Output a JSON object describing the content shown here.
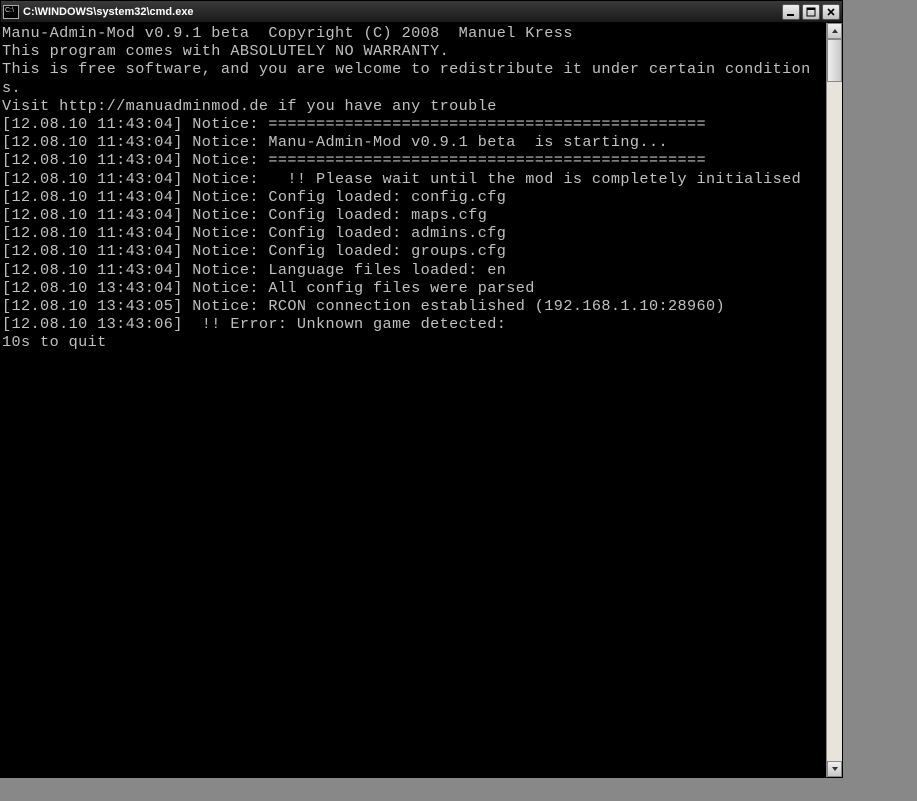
{
  "window": {
    "title": "C:\\WINDOWS\\system32\\cmd.exe"
  },
  "console": {
    "lines": [
      "Manu-Admin-Mod v0.9.1 beta  Copyright (C) 2008  Manuel Kress",
      "This program comes with ABSOLUTELY NO WARRANTY.",
      "This is free software, and you are welcome to redistribute it under certain conditions.",
      "Visit http://manuadminmod.de if you have any trouble",
      "",
      "[12.08.10 11:43:04] Notice: ==============================================",
      "[12.08.10 11:43:04] Notice: Manu-Admin-Mod v0.9.1 beta  is starting...",
      "[12.08.10 11:43:04] Notice: ==============================================",
      "[12.08.10 11:43:04] Notice:   !! Please wait until the mod is completely initialised",
      "[12.08.10 11:43:04] Notice: Config loaded: config.cfg",
      "[12.08.10 11:43:04] Notice: Config loaded: maps.cfg",
      "[12.08.10 11:43:04] Notice: Config loaded: admins.cfg",
      "[12.08.10 11:43:04] Notice: Config loaded: groups.cfg",
      "[12.08.10 11:43:04] Notice: Language files loaded: en",
      "[12.08.10 13:43:04] Notice: All config files were parsed",
      "[12.08.10 13:43:05] Notice: RCON connection established (192.168.1.10:28960)",
      "[12.08.10 13:43:06]  !! Error: Unknown game detected:",
      "10s to quit"
    ]
  },
  "scrollbar": {
    "thumb_top_pct": 0,
    "thumb_height_pct": 6
  }
}
